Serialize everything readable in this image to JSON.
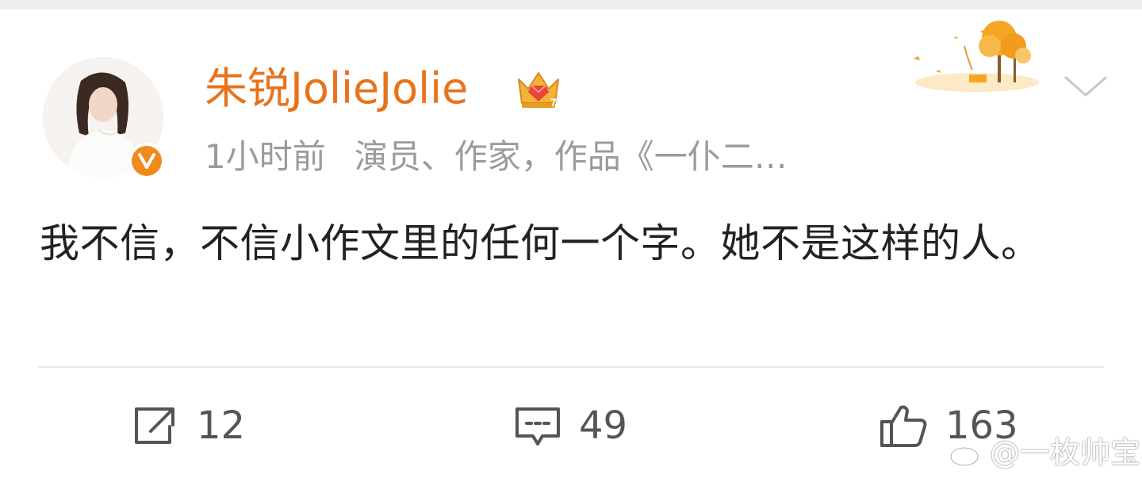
{
  "post": {
    "username": "朱锐JolieJolie",
    "time": "1小时前",
    "bio": "演员、作家，作品《一仆二…",
    "text": "我不信，不信小作文里的任何一个字。她不是这样的人。"
  },
  "actions": {
    "repost_count": "12",
    "comment_count": "49",
    "like_count": "163"
  },
  "watermark": {
    "text": "@一枚帅宝"
  },
  "icons": {
    "verified": "verified-v-icon",
    "crown": "crown-member-icon",
    "decor": "autumn-tree-decoration",
    "chevron": "chevron-down-icon",
    "repost": "share-icon",
    "comment": "comment-icon",
    "like": "thumbs-up-icon"
  },
  "colors": {
    "username": "#e8731c",
    "meta": "#9b9b9b",
    "text": "#222222",
    "verified": "#f08a1c"
  }
}
